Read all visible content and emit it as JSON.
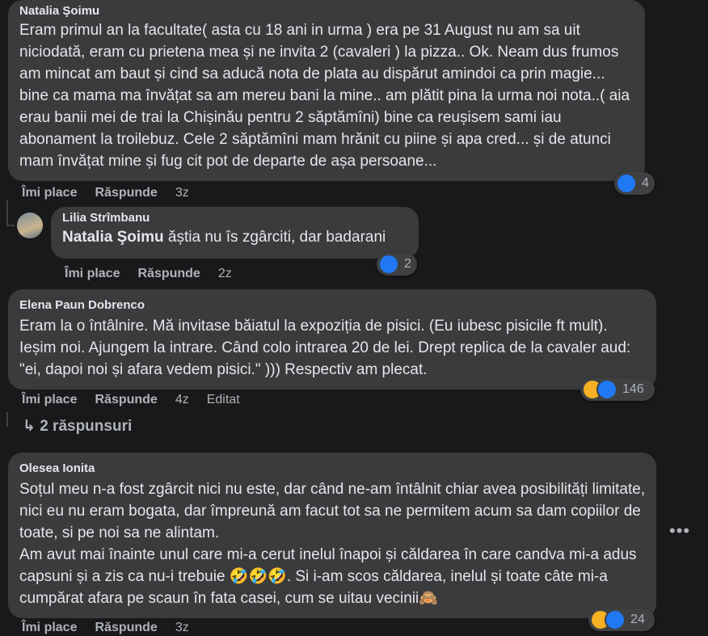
{
  "comments": [
    {
      "author": "Natalia Şoimu",
      "text": "Eram primul an la facultate( asta cu 18 ani in urma ) era pe 31 August nu am sa uit niciodată, eram cu prietena mea și ne invita 2 (cavaleri ) la pizza.. Ok. Neam dus frumos am mincat am baut și cind sa aducă nota de plata au dispărut amindoi ca prin magie... bine ca mama ma învățat sa am mereu bani la mine.. am plătit pina la urma noi nota..( aia erau banii mei de trai la Chișinău pentru 2 săptămîni) bine ca reușisem sami iau abonament la troilebuz. Cele 2 săptămîni mam hrănit cu piine și apa cred... și de atunci mam învățat mine și fug cit pot de departe de așa persoane...",
      "like_label": "Îmi place",
      "reply_label": "Răspunde",
      "time": "3z",
      "reaction_count": "4"
    },
    {
      "author": "Lilia Strîmbanu",
      "mention": "Natalia Şoimu",
      "text": " ăștia nu îs zgârciti, dar badarani",
      "like_label": "Îmi place",
      "reply_label": "Răspunde",
      "time": "2z",
      "reaction_count": "2"
    },
    {
      "author": "Elena Paun Dobrenco",
      "text": "Eram la o întâlnire. Mă invitase băiatul la expoziția de pisici. (Eu iubesc pisicile ft mult). Ieșim noi. Ajungem la intrare. Când colo intrarea 20 de lei. Drept replica de la cavaler aud: \"ei, dapoi noi și afara vedem pisici.\" ))) Respectiv am plecat.",
      "like_label": "Îmi place",
      "reply_label": "Răspunde",
      "time": "4z",
      "edited": "Editat",
      "reaction_count": "146",
      "replies_label": "2 răspunsuri"
    },
    {
      "author": "Olesea Ionita",
      "text": "Soțul meu n-a fost zgârcit nici nu este, dar când ne-am întâlnit chiar avea posibilități limitate, nici eu nu eram bogata, dar împreună am facut tot sa ne permitem acum sa dam copiilor de toate, si pe noi sa ne alintam.\nAm avut mai înainte unul care mi-a cerut inelul înapoi și căldarea în care candva mi-a adus capsuni și a zis ca nu-i trebuie 🤣🤣🤣. Si i-am scos căldarea, inelul și toate câte mi-a cumpărat afara pe scaun în fata casei, cum se uitau vecinii🙈",
      "like_label": "Îmi place",
      "reply_label": "Răspunde",
      "time": "3z",
      "reaction_count": "24"
    }
  ],
  "more_options_icon": "more-horizontal-icon",
  "colors": {
    "background": "#18191a",
    "bubble": "#3a3b3c",
    "like": "#2078f4",
    "haha": "#f7b125"
  }
}
